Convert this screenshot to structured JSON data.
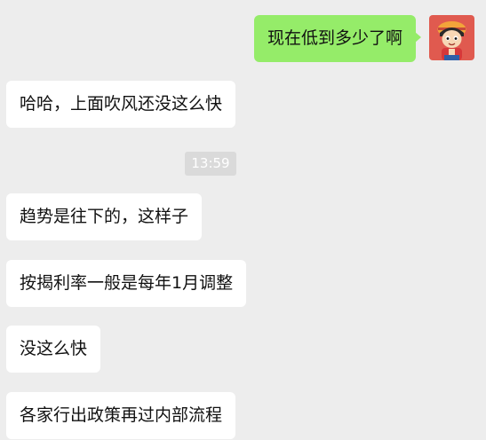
{
  "self": {
    "avatar_icon": "cartoon-avatar-icon",
    "message": "现在低到多少了啊"
  },
  "messages_before_time": [
    "哈哈，上面吹风还没这么快"
  ],
  "timestamp": "13:59",
  "messages_after_time": [
    "趋势是往下的，这样子",
    "按揭利率一般是每年1月调整",
    "没这么快",
    "各家行出政策再过内部流程"
  ],
  "colors": {
    "background": "#EDEDED",
    "incoming_bubble": "#FFFFFF",
    "outgoing_bubble": "#95EC69",
    "timestamp_bg": "#DADADA"
  }
}
